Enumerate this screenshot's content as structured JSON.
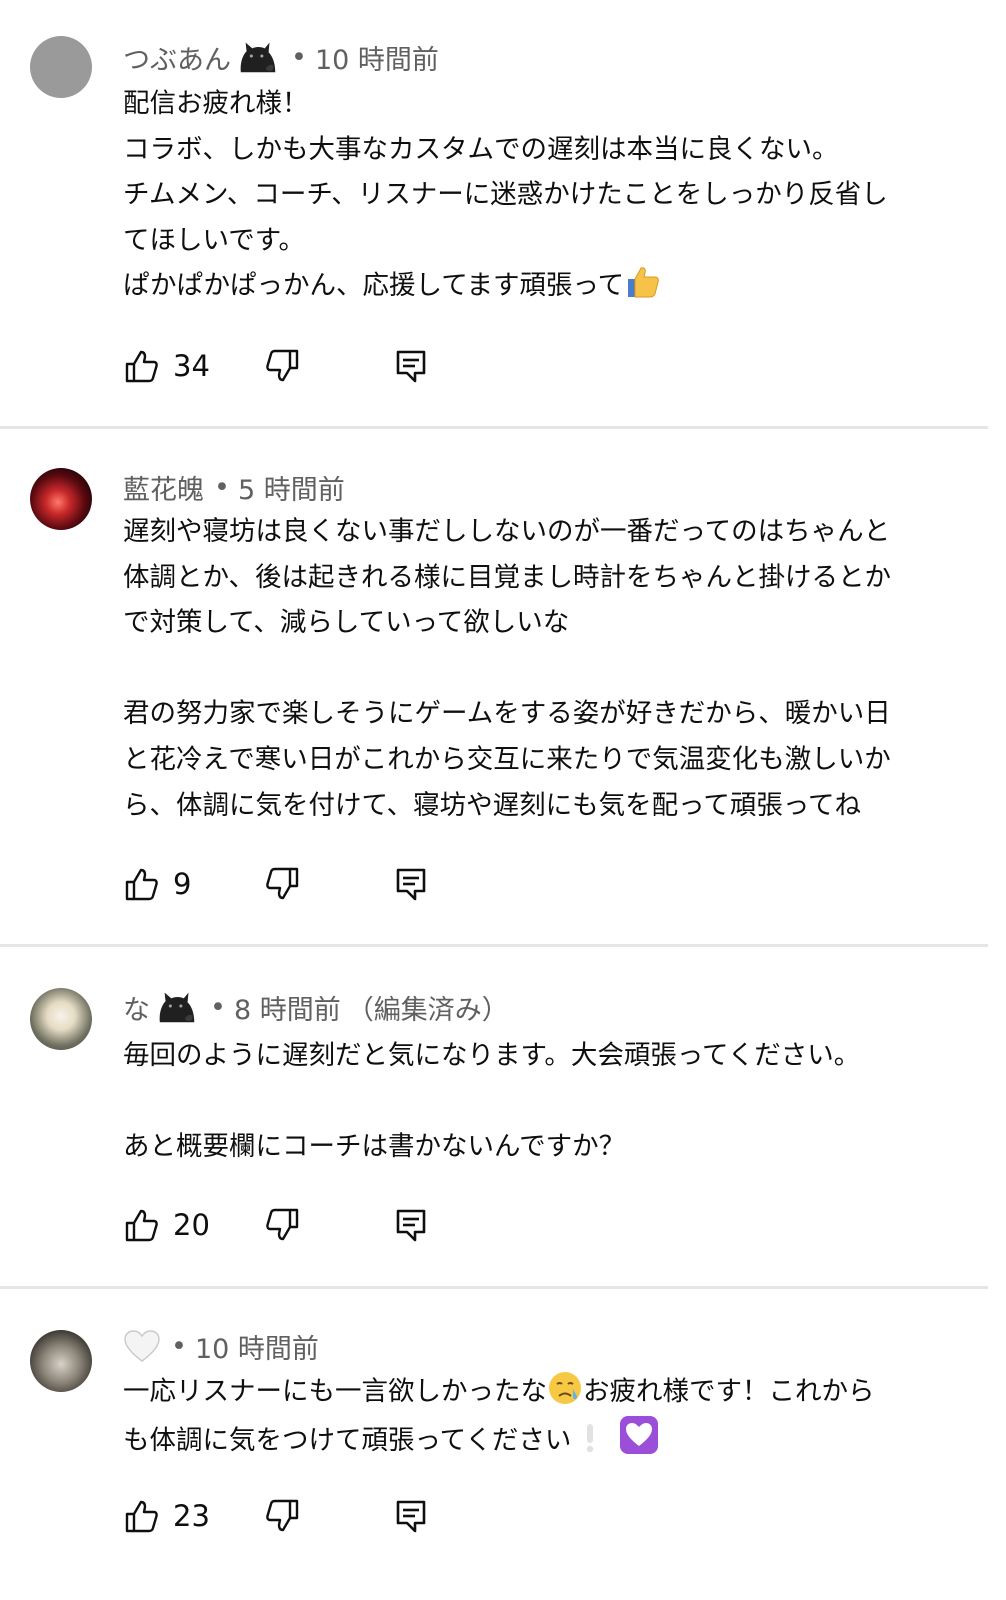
{
  "comments": [
    {
      "author": "つぶあん",
      "time": "10 時間前",
      "lines": [
        "配信お疲れ様！",
        "コラボ、しかも大事なカスタムでの遅刻は本当に良くない。",
        "チムメン、コーチ、リスナーに迷惑かけたことをしっかり反省し",
        "てほしいです。",
        "ぱかぱかぱっかん、応援してます頑張って"
      ],
      "likes": "34"
    },
    {
      "author": "藍花魄",
      "time": "5 時間前",
      "lines": [
        "遅刻や寝坊は良くない事だししないのが一番だってのはちゃんと",
        "体調とか、後は起きれる様に目覚まし時計をちゃんと掛けるとか",
        "で対策して、減らしていって欲しいな",
        "",
        "君の努力家で楽しそうにゲームをする姿が好きだから、暖かい日",
        "と花冷えで寒い日がこれから交互に来たりで気温変化も激しいか",
        "ら、体調に気を付けて、寝坊や遅刻にも気を配って頑張ってね"
      ],
      "likes": "9"
    },
    {
      "author": "な",
      "time": "8 時間前",
      "edited": "（編集済み）",
      "lines": [
        "毎回のように遅刻だと気になります。大会頑張ってください。",
        "",
        "あと概要欄にコーチは書かないんですか？"
      ],
      "likes": "20"
    },
    {
      "author": "",
      "time": "10 時間前",
      "lines": [
        "一応リスナーにも一言欲しかったな",
        "お疲れ様です！これから",
        "も体調に気をつけて頑張ってください"
      ],
      "likes": "23"
    }
  ]
}
